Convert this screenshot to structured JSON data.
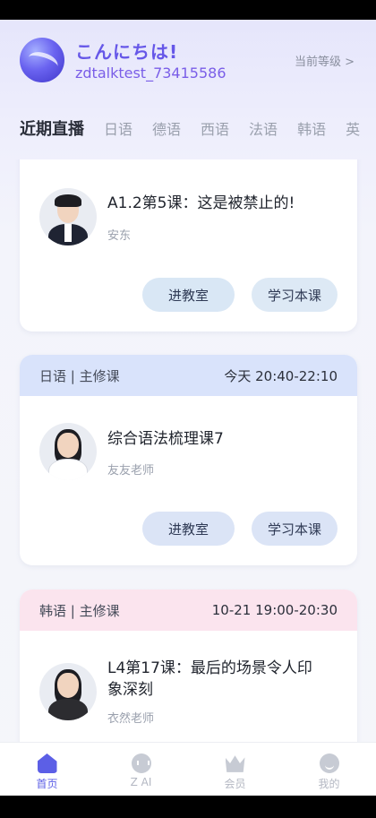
{
  "header": {
    "greeting": "こんにちは!",
    "username": "zdtalktest_73415586",
    "level_link": "当前等级 >"
  },
  "tabs": [
    {
      "label": "近期直播",
      "active": true
    },
    {
      "label": "日语"
    },
    {
      "label": "德语"
    },
    {
      "label": "西语"
    },
    {
      "label": "法语"
    },
    {
      "label": "韩语"
    },
    {
      "label": "英"
    }
  ],
  "cards": [
    {
      "lesson_title": "A1.2第5课：这是被禁止的!",
      "teacher": "安东",
      "enter_label": "进教室",
      "study_label": "学习本课"
    },
    {
      "category": "日语 | 主修课",
      "time": "今天  20:40-22:10",
      "lesson_title": "综合语法梳理课7",
      "teacher": "友友老师",
      "enter_label": "进教室",
      "study_label": "学习本课"
    },
    {
      "category": "韩语 | 主修课",
      "time": "10-21  19:00-20:30",
      "lesson_title": "L4第17课：最后的场景令人印象深刻",
      "teacher": "衣然老师"
    }
  ],
  "bottom_nav": [
    {
      "label": "首页",
      "icon": "home-icon",
      "active": true
    },
    {
      "label": "Z AI",
      "icon": "chat-icon"
    },
    {
      "label": "会员",
      "icon": "crown-icon"
    },
    {
      "label": "我的",
      "icon": "profile-icon"
    }
  ],
  "colors": {
    "accent": "#5c5fe6",
    "greeting": "#6657e8",
    "card_head_blue": "#d9e3fb",
    "card_head_pink": "#fbe4ee",
    "button_bg": "#d9e7f5"
  }
}
